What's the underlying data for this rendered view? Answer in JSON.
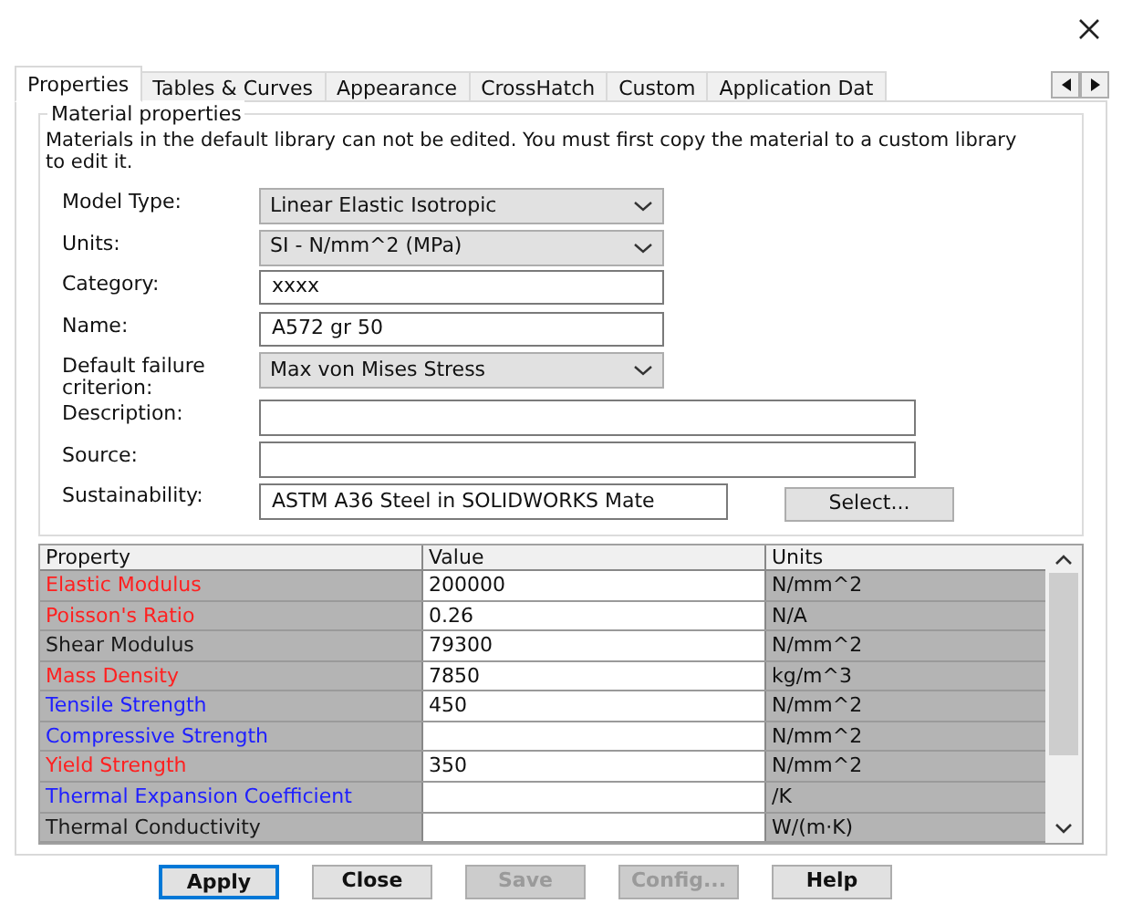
{
  "tabs": [
    {
      "label": "Properties",
      "selected": true
    },
    {
      "label": "Tables & Curves",
      "selected": false
    },
    {
      "label": "Appearance",
      "selected": false
    },
    {
      "label": "CrossHatch",
      "selected": false
    },
    {
      "label": "Custom",
      "selected": false
    },
    {
      "label": "Application Dat",
      "selected": false
    }
  ],
  "group": {
    "title": "Material properties",
    "note": "Materials in the default library can not be edited. You must first copy the material to a custom library to edit it."
  },
  "fields": [
    {
      "kind": "dropdown",
      "label": "Model Type:",
      "value": "Linear Elastic Isotropic"
    },
    {
      "kind": "dropdown",
      "label": "Units:",
      "value": "SI - N/mm^2 (MPa)"
    },
    {
      "kind": "text",
      "label": "Category:",
      "value": "xxxx"
    },
    {
      "kind": "text",
      "label": "Name:",
      "value": "A572 gr 50"
    },
    {
      "kind": "dropdown",
      "label": "Default failure criterion:",
      "value": "Max von Mises Stress"
    },
    {
      "kind": "wide",
      "label": "Description:"
    },
    {
      "kind": "wide",
      "label": "Source:"
    },
    {
      "kind": "select",
      "label": "Sustainability:",
      "value": "ASTM A36 Steel in SOLIDWORKS Mate",
      "button": "Select..."
    }
  ],
  "table": {
    "columns": [
      "Property",
      "Value",
      "Units"
    ],
    "rows": [
      {
        "property": "Elastic Modulus",
        "color": "#ff2020",
        "value": "200000",
        "units": "N/mm^2"
      },
      {
        "property": "Poisson's Ratio",
        "color": "#ff2020",
        "value": "0.26",
        "units": "N/A"
      },
      {
        "property": "Shear Modulus",
        "color": "#1a1a1a",
        "value": "79300",
        "units": "N/mm^2"
      },
      {
        "property": "Mass Density",
        "color": "#ff2020",
        "value": "7850",
        "units": "kg/m^3"
      },
      {
        "property": "Tensile Strength",
        "color": "#2020ff",
        "value": "450",
        "units": "N/mm^2"
      },
      {
        "property": "Compressive Strength",
        "color": "#2020ff",
        "units": "N/mm^2"
      },
      {
        "property": "Yield Strength",
        "color": "#ff2020",
        "value": "350",
        "units": "N/mm^2"
      },
      {
        "property": "Thermal Expansion Coefficient",
        "color": "#2020ff",
        "units": "/K"
      },
      {
        "property": "Thermal Conductivity",
        "color": "#1a1a1a",
        "units": "W/(m·K)"
      }
    ]
  },
  "buttons": [
    {
      "label": "Apply",
      "default": true,
      "disabled": false
    },
    {
      "label": "Close",
      "default": false,
      "disabled": false
    },
    {
      "label": "Save",
      "default": false,
      "disabled": true
    },
    {
      "label": "Config...",
      "default": false,
      "disabled": true
    },
    {
      "label": "Help",
      "default": false,
      "disabled": false
    }
  ]
}
